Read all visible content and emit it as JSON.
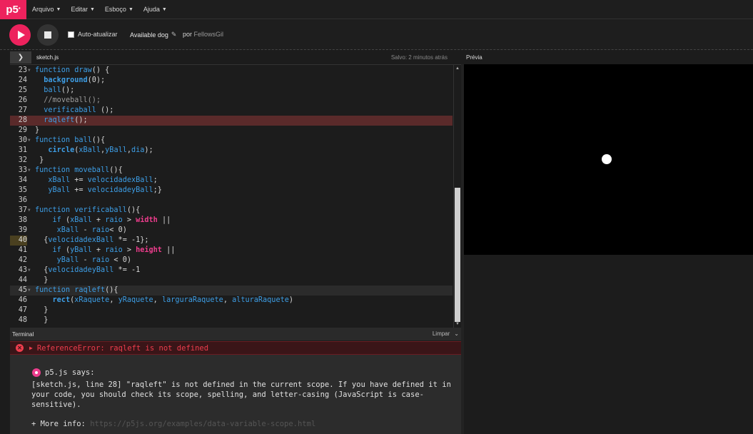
{
  "nav": {
    "logo": "p5",
    "logo_sup": "*",
    "menus": [
      "Arquivo",
      "Editar",
      "Esboço",
      "Ajuda"
    ]
  },
  "toolbar": {
    "auto_refresh_label": "Auto-atualizar",
    "sketch_name": "Available dog",
    "author_prefix": "por",
    "author_name": "FellowsGil"
  },
  "filebar": {
    "filename": "sketch.js",
    "saved_status": "Salvo: 2 minutos atrás",
    "preview_label": "Prévia"
  },
  "editor": {
    "lines": [
      {
        "n": "23",
        "fold": true
      },
      {
        "n": "24"
      },
      {
        "n": "25"
      },
      {
        "n": "26"
      },
      {
        "n": "27"
      },
      {
        "n": "28",
        "state": "error"
      },
      {
        "n": "29"
      },
      {
        "n": "30",
        "fold": true
      },
      {
        "n": "31"
      },
      {
        "n": "32"
      },
      {
        "n": "33",
        "fold": true
      },
      {
        "n": "34"
      },
      {
        "n": "35"
      },
      {
        "n": "36"
      },
      {
        "n": "37",
        "fold": true
      },
      {
        "n": "38"
      },
      {
        "n": "39"
      },
      {
        "n": "40",
        "state": "warning"
      },
      {
        "n": "41"
      },
      {
        "n": "42"
      },
      {
        "n": "43",
        "fold": true
      },
      {
        "n": "44"
      },
      {
        "n": "45",
        "fold": true,
        "state": "active"
      },
      {
        "n": "46"
      },
      {
        "n": "47"
      },
      {
        "n": "48"
      }
    ]
  },
  "console": {
    "title": "Terminal",
    "clear_label": "Limpar",
    "error_text": "ReferenceError: raqleft is not defined",
    "says": "p5.js says:",
    "message": "[sketch.js, line 28] \"raqleft\" is not defined in the current scope. If you have defined it in your code, you should check its scope, spelling, and letter-casing (JavaScript is case-sensitive).",
    "more_label": "+ More info:",
    "more_link": "https://p5js.org/examples/data-variable-scope.html"
  }
}
